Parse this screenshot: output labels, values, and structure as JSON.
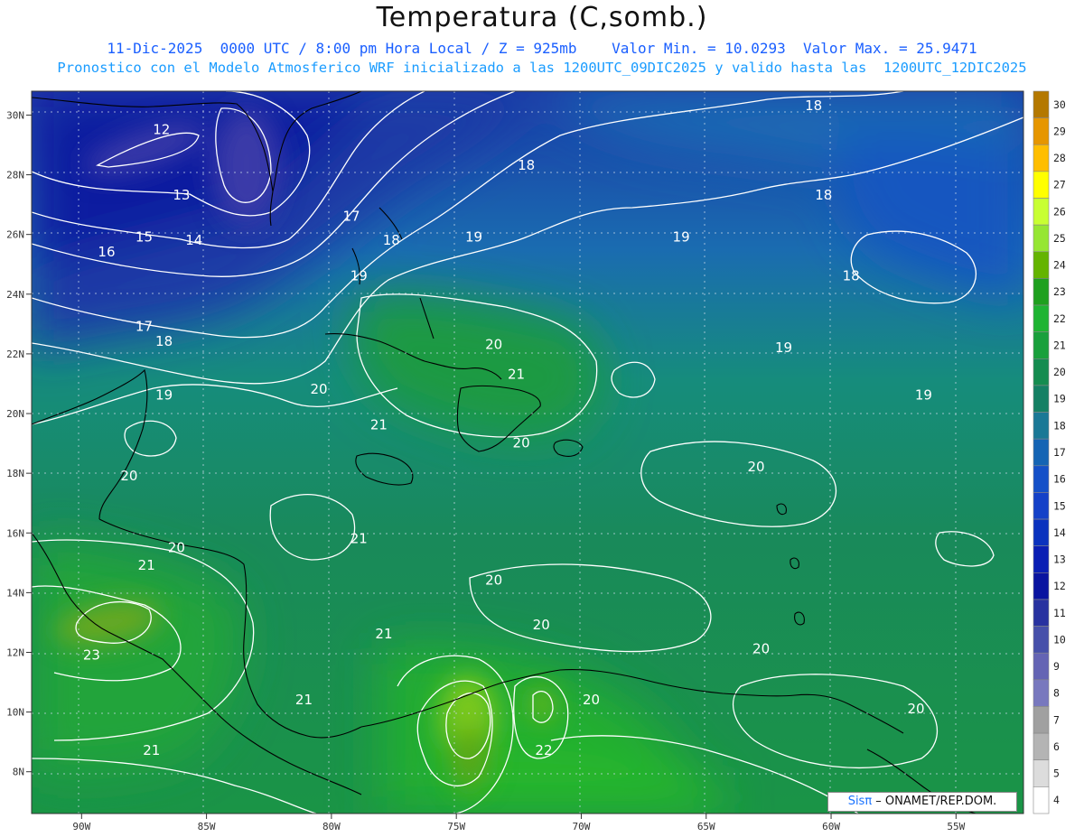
{
  "header": {
    "title": "Temperatura (C,somb.)",
    "subtitle_line1": "11-Dic-2025  0000 UTC / 8:00 pm Hora Local / Z = 925mb    Valor Min. = 10.0293  Valor Max. = 25.9471",
    "subtitle_line2": "Pronostico con el Modelo Atmosferico WRF inicializado a las 1200UTC_09DIC2025 y valido hasta las  1200UTC_12DIC2025"
  },
  "map": {
    "lon_range": [
      -92,
      -52.3
    ],
    "lat_range": [
      6.6,
      30.8
    ],
    "lon_ticks": [
      "90W",
      "85W",
      "80W",
      "75W",
      "70W",
      "65W",
      "60W",
      "55W"
    ],
    "lat_ticks": [
      "30N",
      "28N",
      "26N",
      "24N",
      "22N",
      "20N",
      "18N",
      "16N",
      "14N",
      "12N",
      "10N",
      "8N"
    ],
    "gridlines": "dotted",
    "contour_color": "#ffffff",
    "coastline_color": "#000000",
    "contour_labels": [
      {
        "text": "12",
        "lon": -86.8,
        "lat": 29.5
      },
      {
        "text": "13",
        "lon": -86.0,
        "lat": 27.3
      },
      {
        "text": "14",
        "lon": -85.5,
        "lat": 25.8
      },
      {
        "text": "15",
        "lon": -87.5,
        "lat": 25.9
      },
      {
        "text": "16",
        "lon": -89.0,
        "lat": 25.4
      },
      {
        "text": "17",
        "lon": -87.5,
        "lat": 22.9
      },
      {
        "text": "18",
        "lon": -86.7,
        "lat": 22.4
      },
      {
        "text": "19",
        "lon": -86.7,
        "lat": 20.6
      },
      {
        "text": "17",
        "lon": -79.2,
        "lat": 26.6
      },
      {
        "text": "18",
        "lon": -77.6,
        "lat": 25.8
      },
      {
        "text": "19",
        "lon": -78.9,
        "lat": 24.6
      },
      {
        "text": "19",
        "lon": -74.3,
        "lat": 25.9
      },
      {
        "text": "18",
        "lon": -72.2,
        "lat": 28.3
      },
      {
        "text": "19",
        "lon": -66.0,
        "lat": 25.9
      },
      {
        "text": "18",
        "lon": -60.7,
        "lat": 30.3
      },
      {
        "text": "18",
        "lon": -60.3,
        "lat": 27.3
      },
      {
        "text": "18",
        "lon": -59.2,
        "lat": 24.6
      },
      {
        "text": "19",
        "lon": -61.9,
        "lat": 22.2
      },
      {
        "text": "19",
        "lon": -56.3,
        "lat": 20.6
      },
      {
        "text": "20",
        "lon": -73.5,
        "lat": 22.3
      },
      {
        "text": "21",
        "lon": -72.6,
        "lat": 21.3
      },
      {
        "text": "20",
        "lon": -80.5,
        "lat": 20.8
      },
      {
        "text": "21",
        "lon": -78.1,
        "lat": 19.6
      },
      {
        "text": "20",
        "lon": -72.4,
        "lat": 19.0
      },
      {
        "text": "20",
        "lon": -88.1,
        "lat": 17.9
      },
      {
        "text": "20",
        "lon": -63.0,
        "lat": 18.2
      },
      {
        "text": "20",
        "lon": -86.2,
        "lat": 15.5
      },
      {
        "text": "21",
        "lon": -87.4,
        "lat": 14.9
      },
      {
        "text": "21",
        "lon": -78.9,
        "lat": 15.8
      },
      {
        "text": "20",
        "lon": -73.5,
        "lat": 14.4
      },
      {
        "text": "20",
        "lon": -71.6,
        "lat": 12.9
      },
      {
        "text": "21",
        "lon": -77.9,
        "lat": 12.6
      },
      {
        "text": "20",
        "lon": -62.8,
        "lat": 12.1
      },
      {
        "text": "23",
        "lon": -89.6,
        "lat": 11.9
      },
      {
        "text": "21",
        "lon": -81.1,
        "lat": 10.4
      },
      {
        "text": "20",
        "lon": -69.6,
        "lat": 10.4
      },
      {
        "text": "20",
        "lon": -56.6,
        "lat": 10.1
      },
      {
        "text": "22",
        "lon": -71.5,
        "lat": 8.7
      },
      {
        "text": "21",
        "lon": -87.2,
        "lat": 8.7
      }
    ]
  },
  "colorbar": {
    "levels": [
      "30",
      "29",
      "28",
      "27",
      "26",
      "25",
      "24",
      "23",
      "22",
      "21",
      "20",
      "19",
      "18",
      "17",
      "16",
      "15",
      "14",
      "13",
      "12",
      "11",
      "10",
      "9",
      "8",
      "7",
      "6",
      "5",
      "4"
    ],
    "colors": [
      "#b47800",
      "#e69600",
      "#ffbe00",
      "#ffff00",
      "#c8ff32",
      "#96e632",
      "#64b400",
      "#1ea01e",
      "#1eb432",
      "#19a03c",
      "#148c50",
      "#148064",
      "#1a7896",
      "#1464b4",
      "#1450c8",
      "#1441c8",
      "#0a32be",
      "#0a1eb4",
      "#0a14a0",
      "#2832a0",
      "#4650aa",
      "#6464b4",
      "#7878be",
      "#a0a0a0",
      "#b4b4b4",
      "#dcdcdc",
      "#ffffff"
    ]
  },
  "credit": {
    "sis": "Sisπ",
    "text": " – ONAMET/REP.DOM."
  }
}
